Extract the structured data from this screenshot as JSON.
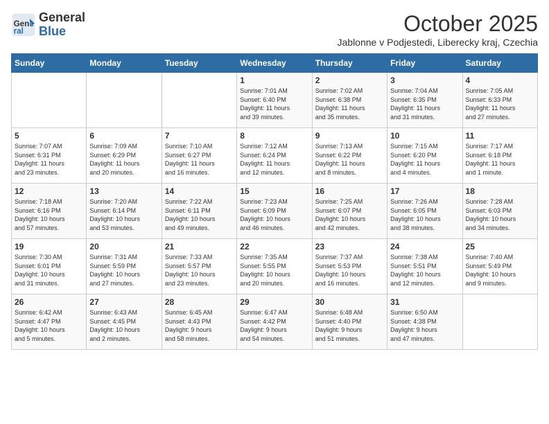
{
  "logo": {
    "general": "General",
    "blue": "Blue"
  },
  "title": {
    "month_year": "October 2025",
    "location": "Jablonne v Podjestedi, Liberecky kraj, Czechia"
  },
  "calendar": {
    "days_of_week": [
      "Sunday",
      "Monday",
      "Tuesday",
      "Wednesday",
      "Thursday",
      "Friday",
      "Saturday"
    ],
    "weeks": [
      [
        {
          "day": "",
          "info": ""
        },
        {
          "day": "",
          "info": ""
        },
        {
          "day": "",
          "info": ""
        },
        {
          "day": "1",
          "info": "Sunrise: 7:01 AM\nSunset: 6:40 PM\nDaylight: 11 hours\nand 39 minutes."
        },
        {
          "day": "2",
          "info": "Sunrise: 7:02 AM\nSunset: 6:38 PM\nDaylight: 11 hours\nand 35 minutes."
        },
        {
          "day": "3",
          "info": "Sunrise: 7:04 AM\nSunset: 6:35 PM\nDaylight: 11 hours\nand 31 minutes."
        },
        {
          "day": "4",
          "info": "Sunrise: 7:05 AM\nSunset: 6:33 PM\nDaylight: 11 hours\nand 27 minutes."
        }
      ],
      [
        {
          "day": "5",
          "info": "Sunrise: 7:07 AM\nSunset: 6:31 PM\nDaylight: 11 hours\nand 23 minutes."
        },
        {
          "day": "6",
          "info": "Sunrise: 7:09 AM\nSunset: 6:29 PM\nDaylight: 11 hours\nand 20 minutes."
        },
        {
          "day": "7",
          "info": "Sunrise: 7:10 AM\nSunset: 6:27 PM\nDaylight: 11 hours\nand 16 minutes."
        },
        {
          "day": "8",
          "info": "Sunrise: 7:12 AM\nSunset: 6:24 PM\nDaylight: 11 hours\nand 12 minutes."
        },
        {
          "day": "9",
          "info": "Sunrise: 7:13 AM\nSunset: 6:22 PM\nDaylight: 11 hours\nand 8 minutes."
        },
        {
          "day": "10",
          "info": "Sunrise: 7:15 AM\nSunset: 6:20 PM\nDaylight: 11 hours\nand 4 minutes."
        },
        {
          "day": "11",
          "info": "Sunrise: 7:17 AM\nSunset: 6:18 PM\nDaylight: 11 hours\nand 1 minute."
        }
      ],
      [
        {
          "day": "12",
          "info": "Sunrise: 7:18 AM\nSunset: 6:16 PM\nDaylight: 10 hours\nand 57 minutes."
        },
        {
          "day": "13",
          "info": "Sunrise: 7:20 AM\nSunset: 6:14 PM\nDaylight: 10 hours\nand 53 minutes."
        },
        {
          "day": "14",
          "info": "Sunrise: 7:22 AM\nSunset: 6:11 PM\nDaylight: 10 hours\nand 49 minutes."
        },
        {
          "day": "15",
          "info": "Sunrise: 7:23 AM\nSunset: 6:09 PM\nDaylight: 10 hours\nand 46 minutes."
        },
        {
          "day": "16",
          "info": "Sunrise: 7:25 AM\nSunset: 6:07 PM\nDaylight: 10 hours\nand 42 minutes."
        },
        {
          "day": "17",
          "info": "Sunrise: 7:26 AM\nSunset: 6:05 PM\nDaylight: 10 hours\nand 38 minutes."
        },
        {
          "day": "18",
          "info": "Sunrise: 7:28 AM\nSunset: 6:03 PM\nDaylight: 10 hours\nand 34 minutes."
        }
      ],
      [
        {
          "day": "19",
          "info": "Sunrise: 7:30 AM\nSunset: 6:01 PM\nDaylight: 10 hours\nand 31 minutes."
        },
        {
          "day": "20",
          "info": "Sunrise: 7:31 AM\nSunset: 5:59 PM\nDaylight: 10 hours\nand 27 minutes."
        },
        {
          "day": "21",
          "info": "Sunrise: 7:33 AM\nSunset: 5:57 PM\nDaylight: 10 hours\nand 23 minutes."
        },
        {
          "day": "22",
          "info": "Sunrise: 7:35 AM\nSunset: 5:55 PM\nDaylight: 10 hours\nand 20 minutes."
        },
        {
          "day": "23",
          "info": "Sunrise: 7:37 AM\nSunset: 5:53 PM\nDaylight: 10 hours\nand 16 minutes."
        },
        {
          "day": "24",
          "info": "Sunrise: 7:38 AM\nSunset: 5:51 PM\nDaylight: 10 hours\nand 12 minutes."
        },
        {
          "day": "25",
          "info": "Sunrise: 7:40 AM\nSunset: 5:49 PM\nDaylight: 10 hours\nand 9 minutes."
        }
      ],
      [
        {
          "day": "26",
          "info": "Sunrise: 6:42 AM\nSunset: 4:47 PM\nDaylight: 10 hours\nand 5 minutes."
        },
        {
          "day": "27",
          "info": "Sunrise: 6:43 AM\nSunset: 4:45 PM\nDaylight: 10 hours\nand 2 minutes."
        },
        {
          "day": "28",
          "info": "Sunrise: 6:45 AM\nSunset: 4:43 PM\nDaylight: 9 hours\nand 58 minutes."
        },
        {
          "day": "29",
          "info": "Sunrise: 6:47 AM\nSunset: 4:42 PM\nDaylight: 9 hours\nand 54 minutes."
        },
        {
          "day": "30",
          "info": "Sunrise: 6:48 AM\nSunset: 4:40 PM\nDaylight: 9 hours\nand 51 minutes."
        },
        {
          "day": "31",
          "info": "Sunrise: 6:50 AM\nSunset: 4:38 PM\nDaylight: 9 hours\nand 47 minutes."
        },
        {
          "day": "",
          "info": ""
        }
      ]
    ]
  }
}
